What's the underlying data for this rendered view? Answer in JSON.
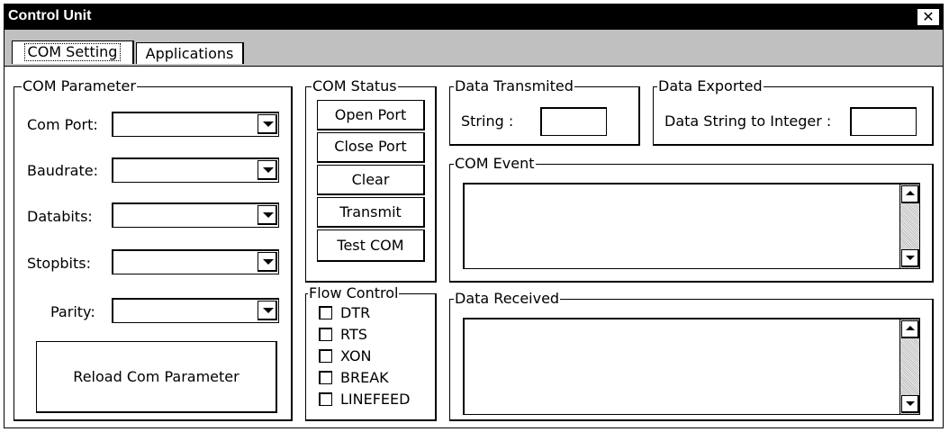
{
  "window": {
    "title": "Control Unit",
    "close_glyph": "✕"
  },
  "tabs": [
    {
      "label": "COM Setting",
      "active": true
    },
    {
      "label": "Applications",
      "active": false
    }
  ],
  "com_parameter": {
    "title": "COM Parameter",
    "fields": [
      {
        "label": "Com Port:",
        "value": ""
      },
      {
        "label": "Baudrate:",
        "value": ""
      },
      {
        "label": "Databits:",
        "value": ""
      },
      {
        "label": "Stopbits:",
        "value": ""
      },
      {
        "label": "Parity:",
        "value": ""
      }
    ],
    "reload_button": "Reload Com Parameter"
  },
  "com_status": {
    "title": "COM Status",
    "buttons": [
      "Open Port",
      "Close Port",
      "Clear",
      "Transmit",
      "Test COM"
    ]
  },
  "flow_control": {
    "title": "Flow Control",
    "options": [
      {
        "label": "DTR",
        "checked": false
      },
      {
        "label": "RTS",
        "checked": false
      },
      {
        "label": "XON",
        "checked": false
      },
      {
        "label": "BREAK",
        "checked": false
      },
      {
        "label": "LINEFEED",
        "checked": false
      }
    ]
  },
  "data_transmitted": {
    "title": "Data Transmited",
    "label": "String :",
    "value": ""
  },
  "data_exported": {
    "title": "Data Exported",
    "label": "Data String to Integer :",
    "value": ""
  },
  "com_event": {
    "title": "COM Event",
    "text": ""
  },
  "data_received": {
    "title": "Data Received",
    "text": ""
  }
}
